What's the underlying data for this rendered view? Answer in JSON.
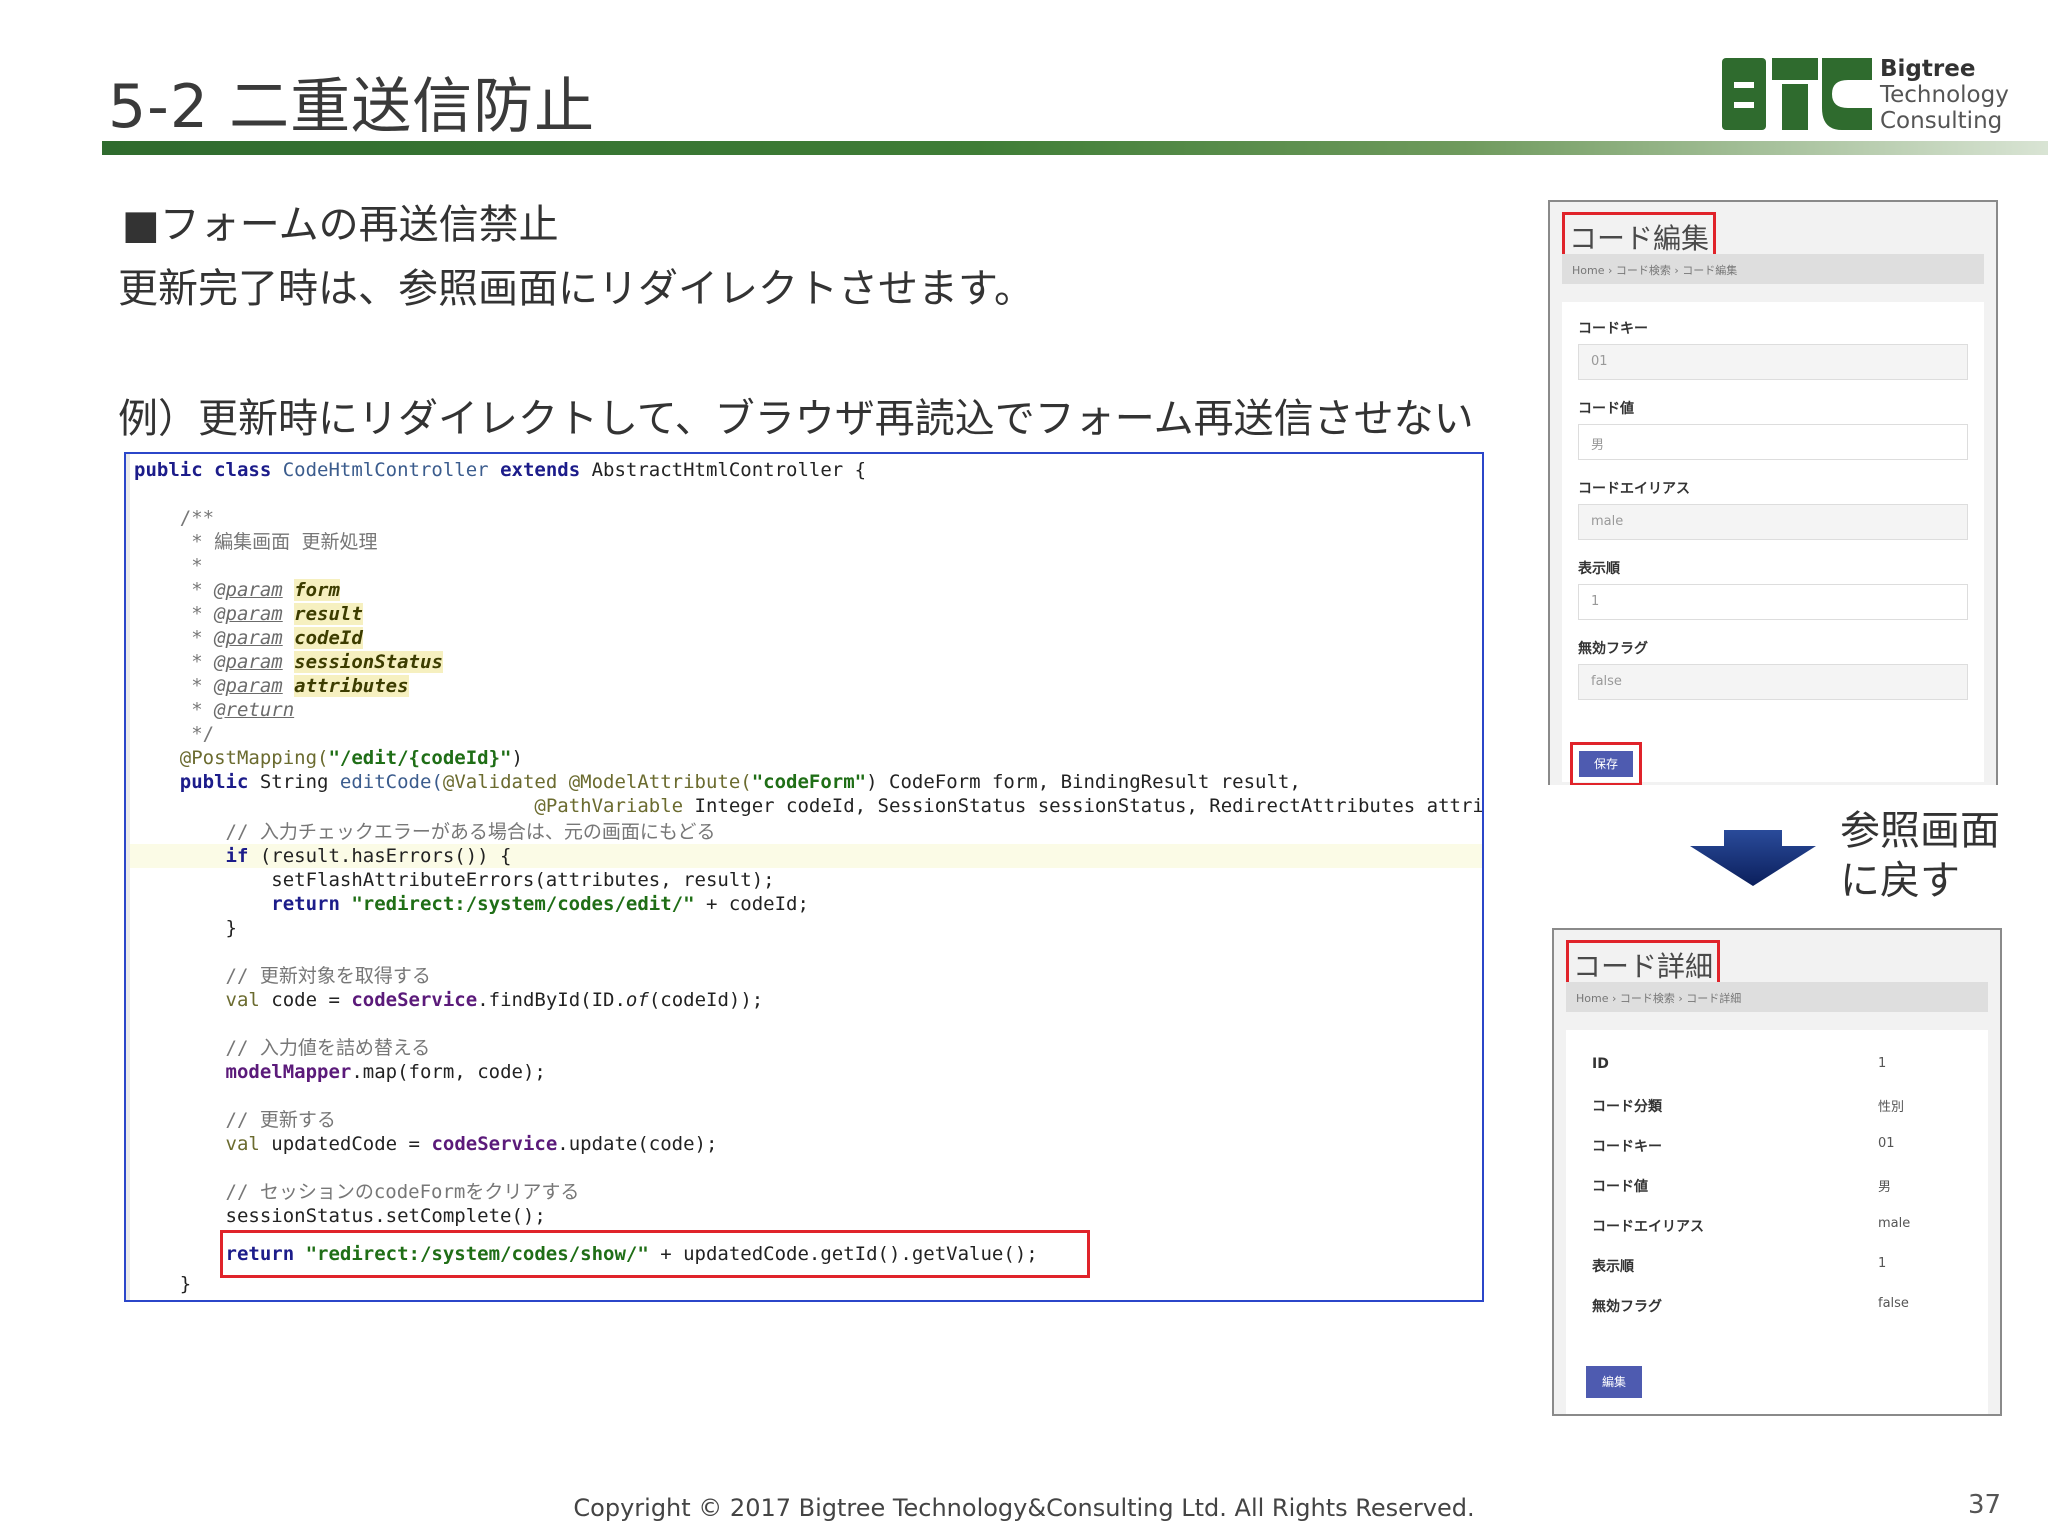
{
  "slide": {
    "title": "5-2 二重送信防止",
    "bullet": "■フォームの再送信禁止",
    "line2": "更新完了時は、参照画面にリダイレクトさせます。",
    "example": "例）更新時にリダイレクトして、ブラウザ再読込でフォーム再送信させない",
    "arrow_note_1": "参照画面",
    "arrow_note_2": "に戻す",
    "copyright": "Copyright © 2017 Bigtree Technology&Consulting Ltd. All Rights Reserved.",
    "page_number": "37"
  },
  "logo": {
    "line1": "Bigtree",
    "line2": "Technology",
    "line3": "Consulting",
    "colors": {
      "mark": "#2f6b2e"
    }
  },
  "code": {
    "l01": "public class ",
    "l01b": "CodeHtmlController ",
    "l01c": "extends ",
    "l01d": "AbstractHtmlController {",
    "l02": "    /**",
    "l03": "     * 編集画面 更新処理",
    "l04": "     *",
    "l05a": "     * ",
    "l05b": "@param",
    "l05c": "form",
    "l06a": "     * ",
    "l06b": "@param",
    "l06c": "result",
    "l07a": "     * ",
    "l07b": "@param",
    "l07c": "codeId",
    "l08a": "     * ",
    "l08b": "@param",
    "l08c": "sessionStatus",
    "l09a": "     * ",
    "l09b": "@param",
    "l09c": "attributes",
    "l10a": "     * ",
    "l10b": "@return",
    "l11": "     */",
    "l12a": "    @PostMapping(",
    "l12b": "\"/edit/{codeId}\"",
    "l12c": ")",
    "l13a": "    public ",
    "l13b": "String ",
    "l13c": "editCode(",
    "l13d": "@Validated @ModelAttribute(",
    "l13e": "\"codeForm\"",
    "l13f": ") CodeForm form, BindingResult result,",
    "l14a": "                                   ",
    "l14b": "@PathVariable ",
    "l14c": "Integer codeId, SessionStatus sessionStatus, RedirectAttributes attributes) {",
    "l15": "        // 入力チェックエラーがある場合は、元の画面にもどる",
    "l16a": "        if ",
    "l16b": "(result.hasErrors()) {",
    "l17": "            setFlashAttributeErrors(attributes, result);",
    "l18a": "            return ",
    "l18b": "\"redirect:/system/codes/edit/\"",
    "l18c": " + codeId;",
    "l19": "        }",
    "l20": "        // 更新対象を取得する",
    "l21a": "        val ",
    "l21b": "code = ",
    "l21c": "codeService",
    "l21d": ".findById(ID.",
    "l21e": "of",
    "l21f": "(codeId));",
    "l22": "        // 入力値を詰め替える",
    "l23a": "        ",
    "l23b": "modelMapper",
    "l23c": ".map(form, code);",
    "l24": "        // 更新する",
    "l25a": "        val ",
    "l25b": "updatedCode = ",
    "l25c": "codeService",
    "l25d": ".update(code);",
    "l26": "        // セッションのcodeFormをクリアする",
    "l27": "        sessionStatus.setComplete();",
    "l28a": "        return ",
    "l28b": "\"redirect:/system/codes/show/\"",
    "l28c": " + updatedCode.getId().getValue();",
    "l29": "    }"
  },
  "edit_panel": {
    "title": "コード編集",
    "breadcrumb": "Home › コード検索 › コード編集",
    "fields": [
      {
        "label": "コードキー",
        "value": "01"
      },
      {
        "label": "コード値",
        "value": "男"
      },
      {
        "label": "コードエイリアス",
        "value": "male"
      },
      {
        "label": "表示順",
        "value": "1"
      },
      {
        "label": "無効フラグ",
        "value": "false"
      }
    ],
    "save_label": "保存"
  },
  "detail_panel": {
    "title": "コード詳細",
    "breadcrumb": "Home › コード検索 › コード詳細",
    "rows": [
      {
        "label": "ID",
        "value": "1"
      },
      {
        "label": "コード分類",
        "value": "性別"
      },
      {
        "label": "コードキー",
        "value": "01"
      },
      {
        "label": "コード値",
        "value": "男"
      },
      {
        "label": "コードエイリアス",
        "value": "male"
      },
      {
        "label": "表示順",
        "value": "1"
      },
      {
        "label": "無効フラグ",
        "value": "false"
      }
    ],
    "edit_label": "編集"
  }
}
